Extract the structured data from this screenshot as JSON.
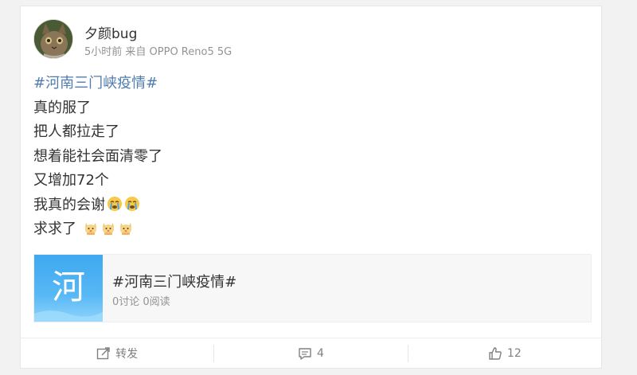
{
  "post": {
    "username": "夕颜bug",
    "meta": "5小时前 来自 OPPO Reno5 5G",
    "hashtag": "#河南三门峡疫情#",
    "lines": [
      "真的服了",
      "把人都拉走了",
      "想着能社会面清零了",
      "又增加72个",
      "我真的会谢",
      "求求了"
    ]
  },
  "topic_card": {
    "image_char": "河",
    "title": "#河南三门峡疫情#",
    "stats": "0讨论 0阅读"
  },
  "actions": {
    "repost_label": "转发",
    "comment_count": "4",
    "like_count": "12"
  },
  "colors": {
    "hashtag": "#507daf",
    "topic_image": "#3fa8f0",
    "muted": "#939393"
  },
  "icons": {
    "crying": "crying-emoji-icon",
    "cat": "cat-emoji-icon"
  }
}
